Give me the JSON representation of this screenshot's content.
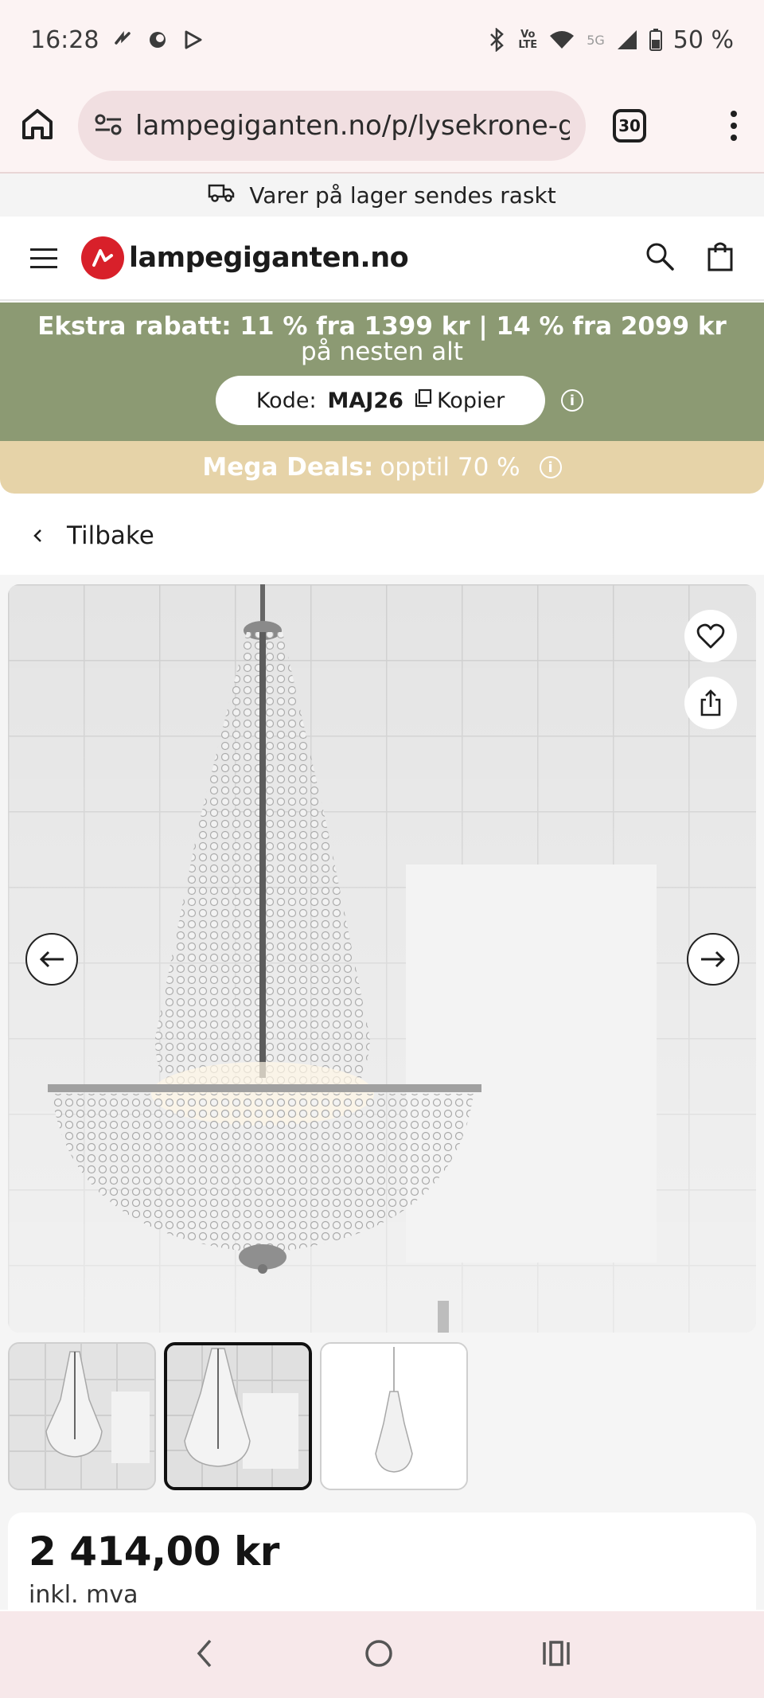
{
  "status_bar": {
    "time": "16:28",
    "battery": "50 %",
    "network_label": "5G",
    "volte_label": "Vo\nLTE"
  },
  "browser": {
    "url": "lampegiganten.no/p/lysekrone-gra",
    "tab_count": "30"
  },
  "shipping": {
    "text": "Varer på lager sendes raskt"
  },
  "site": {
    "logo_text": "lampegiganten.no",
    "brand_color": "#d8202a"
  },
  "promo": {
    "bold_text": "Ekstra rabatt: 11 % fra 1399 kr | 14 % fra 2099 kr",
    "rest_text": " på nesten alt",
    "code_label": "Kode:",
    "code_value": "MAJ26",
    "copy_label": "Kopier",
    "bg_color": "#8c9a73"
  },
  "mega_deals": {
    "bold_text": "Mega Deals:",
    "rest_text": "opptil 70 %",
    "bg_color": "#e6d3a8"
  },
  "back": {
    "label": "Tilbake"
  },
  "product": {
    "price": "2 414,00 kr",
    "vat_note": "inkl. mva"
  }
}
